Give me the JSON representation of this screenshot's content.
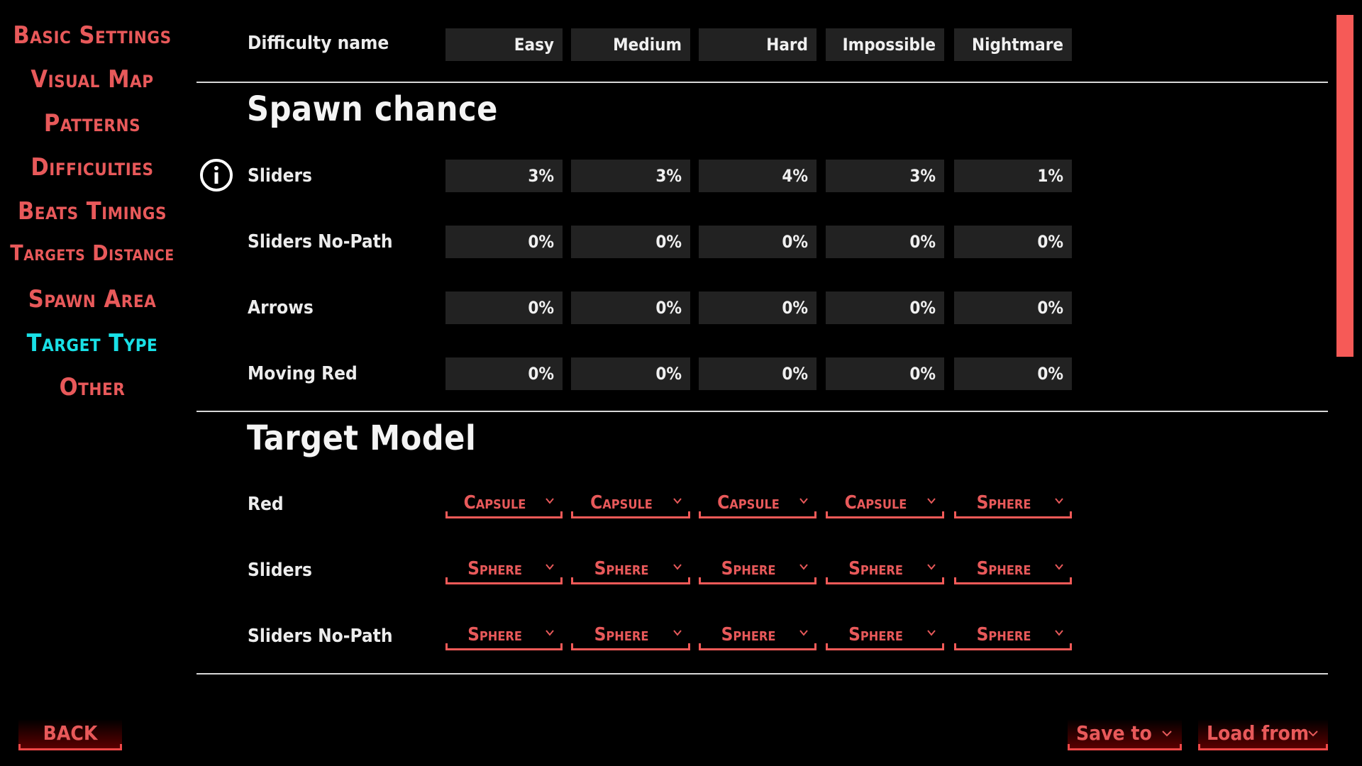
{
  "sidebar": {
    "items": [
      {
        "label": "Basic Settings",
        "active": false
      },
      {
        "label": "Visual Map",
        "active": false
      },
      {
        "label": "Patterns",
        "active": false
      },
      {
        "label": "Difficulties",
        "active": false
      },
      {
        "label": "Beats Timings",
        "active": false
      },
      {
        "label": "Targets Distance",
        "active": false
      },
      {
        "label": "Spawn Area",
        "active": false
      },
      {
        "label": "Target Type",
        "active": true
      },
      {
        "label": "Other",
        "active": false
      }
    ]
  },
  "header": {
    "label": "Difficulty name",
    "difficulties": [
      "Easy",
      "Medium",
      "Hard",
      "Impossible",
      "Nightmare"
    ]
  },
  "spawn_chance": {
    "title": "Spawn chance",
    "info_icon": "info-icon",
    "rows": [
      {
        "label": "Sliders",
        "values": [
          "3%",
          "3%",
          "4%",
          "3%",
          "1%"
        ]
      },
      {
        "label": "Sliders No-Path",
        "values": [
          "0%",
          "0%",
          "0%",
          "0%",
          "0%"
        ]
      },
      {
        "label": "Arrows",
        "values": [
          "0%",
          "0%",
          "0%",
          "0%",
          "0%"
        ]
      },
      {
        "label": "Moving Red",
        "values": [
          "0%",
          "0%",
          "0%",
          "0%",
          "0%"
        ]
      }
    ]
  },
  "target_model": {
    "title": "Target Model",
    "rows": [
      {
        "label": "Red",
        "values": [
          "Capsule",
          "Capsule",
          "Capsule",
          "Capsule",
          "Sphere"
        ]
      },
      {
        "label": "Sliders",
        "values": [
          "Sphere",
          "Sphere",
          "Sphere",
          "Sphere",
          "Sphere"
        ]
      },
      {
        "label": "Sliders No-Path",
        "values": [
          "Sphere",
          "Sphere",
          "Sphere",
          "Sphere",
          "Sphere"
        ]
      }
    ]
  },
  "footer": {
    "back_label": "BACK",
    "save_label": "Save to",
    "load_label": "Load from"
  },
  "colors": {
    "accent_red": "#e8595a",
    "active_cyan": "#19e0e6",
    "scrollbar": "#f65a57",
    "cell_bg": "#222222"
  }
}
